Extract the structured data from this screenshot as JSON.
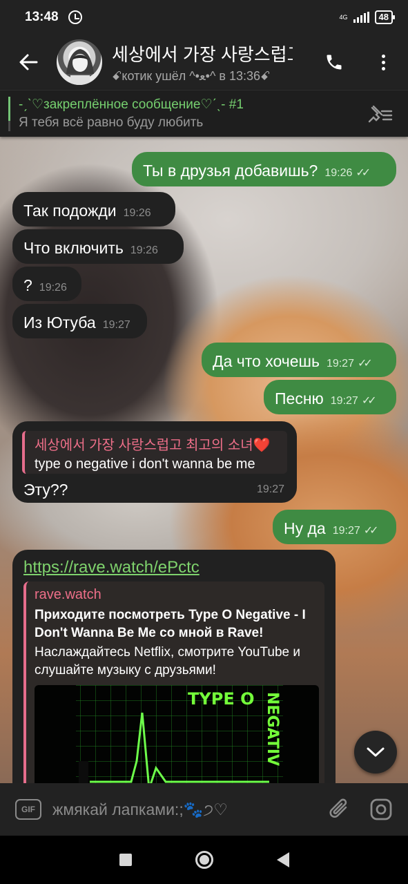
{
  "status_bar": {
    "time": "13:48",
    "network": "4G",
    "battery": "48"
  },
  "header": {
    "title": "세상에서 가장 사랑스럽고",
    "status": "ꗃкотик ушёл ^•ﻌ•^ в 13:36ꗃ",
    "icons": [
      "back-arrow-icon",
      "phone-icon",
      "more-vert-icon"
    ]
  },
  "pinned": {
    "title": "-ˏˋ♡закреплённое сообщение♡ˊˎ- #1",
    "text": "Я тебя всё равно буду любить"
  },
  "messages": [
    {
      "dir": "out",
      "text": "Ты в друзья добавишь?",
      "time": "19:26"
    },
    {
      "dir": "in",
      "text": "Так подожди",
      "time": "19:26"
    },
    {
      "dir": "in",
      "text": "Что включить",
      "time": "19:26"
    },
    {
      "dir": "in",
      "text": "?",
      "time": "19:26"
    },
    {
      "dir": "in",
      "text": "Из Ютуба",
      "time": "19:27"
    },
    {
      "dir": "out",
      "text": "Да что хочешь",
      "time": "19:27"
    },
    {
      "dir": "out",
      "text": "Песню",
      "time": "19:27"
    },
    {
      "dir": "in",
      "reply_name": "세상에서 가장 사랑스럽고 최고의 소녀❤️",
      "reply_text": "type o negative i don't wanna be me",
      "text": "Эту??",
      "time": "19:27"
    },
    {
      "dir": "out",
      "text": "Ну да",
      "time": "19:27"
    }
  ],
  "link_message": {
    "url": "https://rave.watch/ePctc",
    "site": "rave.watch",
    "title": "Приходите посмотреть Type O Negative - I Don't Wanna Be Me со мной в Rave!",
    "description": "Наслаждайтесь Netflix, смотрите YouTube и слушайте музыку с друзьями!",
    "image_text": {
      "horizontal": "TYPE O",
      "vertical": "NEGATIV"
    }
  },
  "input": {
    "placeholder": "жмякай лапками:;🐾੭♡",
    "gif_label": "GIF"
  },
  "colors": {
    "outgoing": "#3f8b43",
    "incoming": "#212121",
    "accent_green": "#76d06f",
    "accent_pink": "#ee6f89"
  }
}
